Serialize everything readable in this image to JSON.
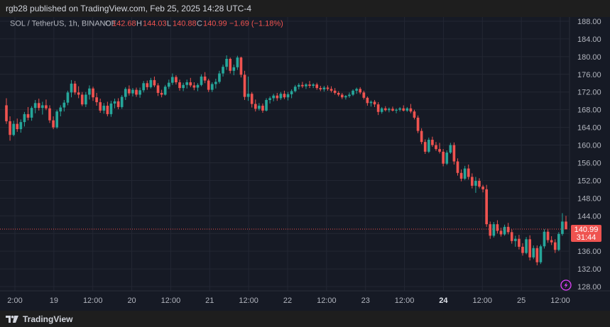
{
  "header": {
    "publisher_text": "rgb28 published on TradingView.com, Feb 25, 2025 14:28 UTC-4"
  },
  "legend": {
    "symbol": "SOL / TetherUS, 1h, BINANCE",
    "open_label": "O",
    "open_value": "142.68",
    "high_label": "H",
    "high_value": "144.03",
    "low_label": "L",
    "low_value": "140.88",
    "close_label": "C",
    "close_value": "140.99",
    "change": "−1.69 (−1.18%)"
  },
  "price_tag": {
    "price": "140.99",
    "countdown": "31:44"
  },
  "footer": {
    "brand": "TradingView"
  },
  "colors": {
    "background": "#161a25",
    "grid": "#232733",
    "up": "#26a69a",
    "down": "#ef5350",
    "axis_text": "#b2b5be",
    "price_line": "#ef5350"
  },
  "chart_data": {
    "type": "candlestick",
    "symbol": "SOL / TetherUS",
    "interval": "1h",
    "exchange": "BINANCE",
    "y_axis": {
      "ticks": [
        "188.00",
        "184.00",
        "180.00",
        "176.00",
        "172.00",
        "168.00",
        "164.00",
        "160.00",
        "156.00",
        "152.00",
        "148.00",
        "144.00",
        "140.00",
        "136.00",
        "132.00",
        "128.00"
      ],
      "min": 126.0,
      "max": 190.0
    },
    "x_axis": {
      "ticks": [
        {
          "label": "2:00",
          "bold": false
        },
        {
          "label": "19",
          "bold": false
        },
        {
          "label": "12:00",
          "bold": false
        },
        {
          "label": "20",
          "bold": false
        },
        {
          "label": "12:00",
          "bold": false
        },
        {
          "label": "21",
          "bold": false
        },
        {
          "label": "12:00",
          "bold": false
        },
        {
          "label": "22",
          "bold": false
        },
        {
          "label": "12:00",
          "bold": false
        },
        {
          "label": "23",
          "bold": false
        },
        {
          "label": "12:00",
          "bold": false
        },
        {
          "label": "24",
          "bold": true
        },
        {
          "label": "12:00",
          "bold": false
        },
        {
          "label": "25",
          "bold": false
        },
        {
          "label": "12:00",
          "bold": false
        }
      ]
    },
    "last_price": 140.99,
    "candles": [
      [
        169.0,
        170.6,
        164.8,
        165.4
      ],
      [
        165.4,
        166.5,
        161.0,
        162.3
      ],
      [
        162.3,
        165.5,
        162.0,
        164.8
      ],
      [
        164.8,
        166.0,
        163.0,
        163.6
      ],
      [
        163.6,
        165.8,
        162.8,
        165.2
      ],
      [
        165.2,
        167.5,
        164.2,
        167.0
      ],
      [
        167.0,
        168.6,
        165.6,
        166.2
      ],
      [
        166.2,
        168.8,
        165.5,
        168.4
      ],
      [
        168.4,
        170.2,
        167.2,
        169.5
      ],
      [
        169.5,
        170.5,
        167.8,
        168.4
      ],
      [
        168.4,
        169.8,
        166.9,
        169.0
      ],
      [
        169.0,
        170.3,
        167.9,
        168.3
      ],
      [
        168.3,
        169.0,
        165.0,
        165.6
      ],
      [
        165.6,
        166.5,
        163.6,
        164.0
      ],
      [
        164.0,
        168.0,
        163.7,
        167.6
      ],
      [
        167.6,
        169.0,
        166.5,
        168.5
      ],
      [
        168.5,
        170.2,
        167.6,
        169.6
      ],
      [
        169.6,
        172.3,
        169.0,
        171.9
      ],
      [
        171.9,
        174.7,
        170.8,
        173.9
      ],
      [
        173.9,
        174.5,
        171.4,
        171.9
      ],
      [
        171.9,
        173.3,
        170.6,
        171.4
      ],
      [
        171.4,
        172.0,
        168.8,
        169.2
      ],
      [
        169.2,
        172.0,
        168.6,
        171.4
      ],
      [
        171.4,
        173.5,
        170.3,
        172.8
      ],
      [
        172.8,
        173.2,
        170.0,
        170.8
      ],
      [
        170.8,
        171.8,
        168.9,
        169.7
      ],
      [
        169.7,
        170.5,
        167.3,
        167.8
      ],
      [
        167.8,
        169.5,
        167.1,
        168.9
      ],
      [
        168.9,
        169.8,
        166.5,
        167.0
      ],
      [
        167.0,
        170.0,
        166.4,
        169.4
      ],
      [
        169.4,
        170.5,
        168.3,
        169.9
      ],
      [
        169.9,
        170.6,
        168.1,
        168.6
      ],
      [
        168.6,
        171.3,
        168.2,
        170.9
      ],
      [
        170.9,
        173.1,
        170.2,
        172.7
      ],
      [
        172.7,
        173.5,
        171.2,
        171.7
      ],
      [
        171.7,
        172.9,
        171.0,
        172.5
      ],
      [
        172.5,
        173.0,
        170.9,
        171.4
      ],
      [
        171.4,
        173.0,
        170.7,
        172.4
      ],
      [
        172.4,
        174.5,
        171.9,
        174.0
      ],
      [
        174.0,
        174.6,
        172.5,
        173.1
      ],
      [
        173.1,
        175.2,
        172.8,
        174.7
      ],
      [
        174.7,
        175.5,
        173.1,
        173.5
      ],
      [
        173.5,
        174.0,
        171.1,
        171.8
      ],
      [
        171.8,
        172.5,
        170.8,
        171.4
      ],
      [
        171.4,
        173.6,
        171.2,
        173.2
      ],
      [
        173.2,
        174.8,
        172.7,
        174.1
      ],
      [
        174.1,
        176.2,
        173.6,
        175.4
      ],
      [
        175.4,
        175.8,
        173.7,
        174.2
      ],
      [
        174.2,
        174.8,
        172.3,
        172.9
      ],
      [
        172.9,
        174.1,
        172.2,
        173.6
      ],
      [
        173.6,
        174.8,
        172.8,
        174.2
      ],
      [
        174.2,
        175.2,
        173.1,
        173.5
      ],
      [
        173.5,
        174.2,
        172.4,
        173.0
      ],
      [
        173.0,
        174.0,
        172.2,
        173.6
      ],
      [
        173.6,
        176.0,
        173.3,
        175.5
      ],
      [
        175.5,
        176.5,
        174.0,
        174.6
      ],
      [
        174.6,
        175.0,
        172.0,
        172.5
      ],
      [
        172.5,
        174.2,
        172.0,
        173.8
      ],
      [
        173.8,
        175.0,
        172.8,
        174.3
      ],
      [
        174.3,
        176.8,
        173.9,
        176.2
      ],
      [
        176.2,
        178.2,
        175.5,
        177.7
      ],
      [
        177.7,
        180.3,
        177.0,
        179.5
      ],
      [
        179.5,
        179.8,
        176.2,
        176.8
      ],
      [
        176.8,
        178.2,
        175.8,
        177.6
      ],
      [
        177.6,
        180.2,
        177.0,
        179.8
      ],
      [
        179.8,
        180.0,
        175.3,
        175.9
      ],
      [
        175.9,
        176.8,
        170.2,
        170.9
      ],
      [
        170.9,
        175.5,
        170.0,
        171.6
      ],
      [
        171.6,
        172.0,
        168.5,
        169.3
      ],
      [
        169.3,
        170.3,
        167.6,
        168.2
      ],
      [
        168.2,
        169.5,
        167.8,
        168.9
      ],
      [
        168.9,
        169.4,
        167.3,
        167.8
      ],
      [
        167.8,
        170.6,
        167.6,
        170.2
      ],
      [
        170.2,
        171.0,
        169.4,
        170.6
      ],
      [
        170.6,
        171.6,
        169.9,
        171.2
      ],
      [
        171.2,
        171.8,
        170.0,
        170.6
      ],
      [
        170.6,
        172.0,
        170.2,
        171.6
      ],
      [
        171.6,
        172.3,
        170.4,
        170.8
      ],
      [
        170.8,
        172.0,
        170.1,
        171.5
      ],
      [
        171.5,
        172.6,
        170.6,
        172.2
      ],
      [
        172.2,
        173.6,
        171.9,
        173.2
      ],
      [
        173.2,
        174.0,
        172.6,
        173.6
      ],
      [
        173.6,
        174.3,
        172.9,
        173.3
      ],
      [
        173.3,
        174.0,
        172.7,
        173.7
      ],
      [
        173.7,
        174.5,
        172.9,
        173.4
      ],
      [
        173.4,
        174.0,
        172.9,
        173.7
      ],
      [
        173.7,
        174.1,
        172.5,
        172.9
      ],
      [
        172.9,
        173.4,
        172.2,
        172.6
      ],
      [
        172.6,
        173.4,
        172.1,
        173.0
      ],
      [
        173.0,
        173.5,
        172.3,
        172.7
      ],
      [
        172.7,
        173.3,
        171.9,
        172.3
      ],
      [
        172.3,
        172.9,
        171.4,
        171.8
      ],
      [
        171.8,
        172.2,
        171.0,
        171.4
      ],
      [
        171.4,
        171.8,
        170.4,
        170.8
      ],
      [
        170.8,
        171.3,
        170.3,
        171.1
      ],
      [
        171.1,
        171.9,
        170.7,
        171.4
      ],
      [
        171.4,
        172.6,
        171.1,
        172.3
      ],
      [
        172.3,
        173.0,
        171.6,
        172.7
      ],
      [
        172.7,
        173.1,
        171.5,
        171.9
      ],
      [
        171.9,
        172.3,
        170.3,
        170.7
      ],
      [
        170.7,
        171.0,
        168.9,
        169.5
      ],
      [
        169.5,
        170.1,
        168.7,
        169.8
      ],
      [
        169.8,
        170.2,
        168.6,
        169.2
      ],
      [
        169.2,
        169.7,
        166.8,
        167.5
      ],
      [
        167.5,
        168.6,
        167.1,
        168.3
      ],
      [
        168.3,
        168.8,
        167.6,
        167.9
      ],
      [
        167.9,
        168.5,
        167.4,
        168.2
      ],
      [
        168.2,
        168.7,
        167.6,
        167.8
      ],
      [
        167.8,
        168.3,
        167.2,
        168.0
      ],
      [
        168.0,
        168.6,
        167.6,
        168.3
      ],
      [
        168.3,
        169.0,
        167.6,
        167.8
      ],
      [
        167.8,
        168.6,
        167.5,
        168.3
      ],
      [
        168.3,
        169.3,
        167.2,
        167.6
      ],
      [
        167.6,
        168.0,
        165.8,
        166.2
      ],
      [
        166.2,
        166.7,
        162.7,
        163.2
      ],
      [
        163.2,
        163.8,
        160.2,
        160.7
      ],
      [
        160.7,
        161.3,
        158.0,
        158.5
      ],
      [
        158.5,
        161.7,
        158.2,
        161.2
      ],
      [
        161.2,
        161.9,
        159.6,
        160.0
      ],
      [
        160.0,
        160.7,
        158.7,
        159.1
      ],
      [
        159.1,
        160.5,
        158.1,
        158.5
      ],
      [
        158.5,
        159.1,
        155.2,
        155.8
      ],
      [
        155.8,
        158.8,
        155.5,
        158.3
      ],
      [
        158.3,
        160.5,
        158.0,
        160.0
      ],
      [
        160.0,
        160.6,
        155.6,
        156.3
      ],
      [
        156.3,
        157.0,
        153.1,
        153.7
      ],
      [
        153.7,
        154.5,
        151.8,
        152.4
      ],
      [
        152.4,
        155.3,
        152.1,
        154.7
      ],
      [
        154.7,
        155.6,
        152.2,
        152.8
      ],
      [
        152.8,
        153.6,
        150.2,
        150.8
      ],
      [
        150.8,
        152.8,
        149.2,
        151.9
      ],
      [
        151.9,
        152.5,
        150.2,
        150.6
      ],
      [
        150.6,
        151.0,
        149.3,
        150.0
      ],
      [
        150.0,
        151.0,
        141.5,
        142.1
      ],
      [
        142.1,
        142.7,
        138.8,
        139.5
      ],
      [
        139.5,
        142.6,
        139.1,
        142.1
      ],
      [
        142.1,
        143.0,
        140.0,
        140.6
      ],
      [
        140.6,
        141.3,
        139.3,
        139.8
      ],
      [
        139.8,
        142.0,
        139.5,
        141.5
      ],
      [
        141.5,
        142.4,
        139.8,
        140.3
      ],
      [
        140.3,
        140.9,
        137.7,
        138.3
      ],
      [
        138.3,
        139.5,
        137.0,
        138.8
      ],
      [
        138.8,
        139.7,
        136.4,
        137.0
      ],
      [
        137.0,
        137.8,
        135.0,
        135.6
      ],
      [
        135.6,
        139.2,
        135.3,
        138.7
      ],
      [
        138.7,
        139.6,
        133.9,
        134.6
      ],
      [
        134.6,
        137.3,
        134.2,
        136.7
      ],
      [
        136.7,
        137.3,
        132.8,
        133.5
      ],
      [
        133.5,
        137.5,
        133.1,
        137.1
      ],
      [
        137.1,
        141.0,
        136.6,
        140.4
      ],
      [
        140.4,
        141.1,
        137.9,
        138.5
      ],
      [
        138.5,
        139.4,
        137.4,
        138.0
      ],
      [
        138.0,
        138.7,
        135.6,
        136.3
      ],
      [
        136.3,
        140.3,
        136.0,
        139.9
      ],
      [
        139.9,
        144.6,
        139.5,
        142.7
      ],
      [
        142.7,
        144.0,
        140.9,
        141.0
      ]
    ]
  }
}
